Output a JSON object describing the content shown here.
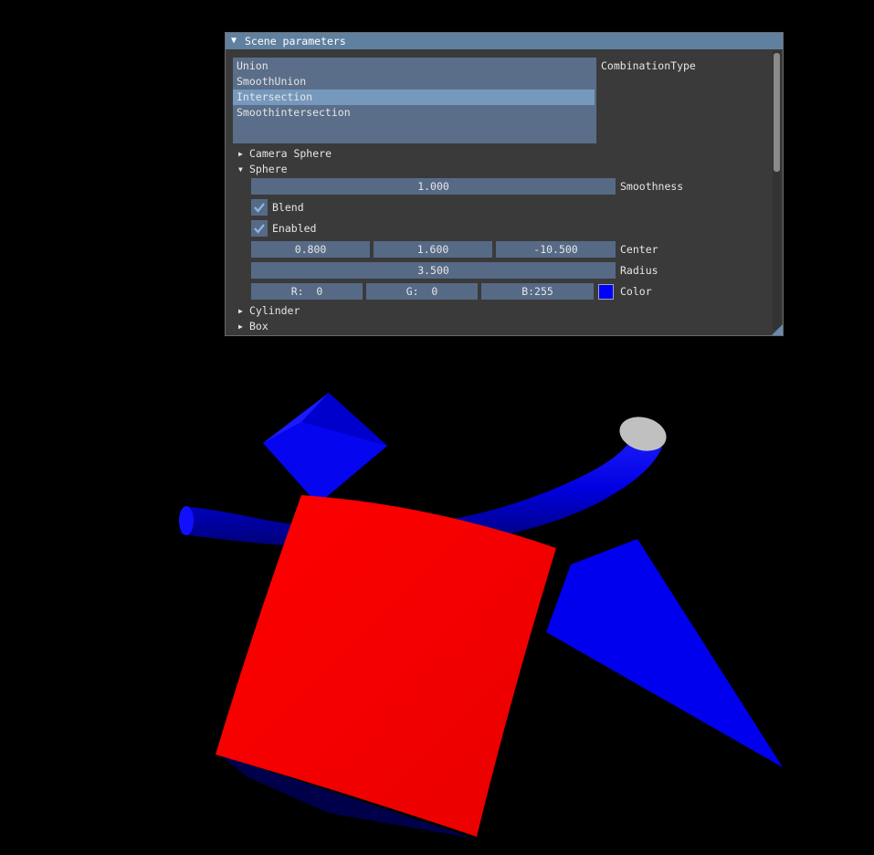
{
  "window": {
    "title": "Scene parameters",
    "combination_list": {
      "items": [
        "Union",
        "SmoothUnion",
        "Intersection",
        "Smoothintersection"
      ],
      "selected_index": 2,
      "label": "CombinationType"
    },
    "nodes": {
      "camera_sphere": "Camera Sphere",
      "sphere": "Sphere",
      "cylinder": "Cylinder",
      "box": "Box"
    },
    "sphere": {
      "smoothness_value": "1.000",
      "smoothness_label": "Smoothness",
      "blend_label": "Blend",
      "blend_checked": true,
      "enabled_label": "Enabled",
      "enabled_checked": true,
      "center_x": "0.800",
      "center_y": "1.600",
      "center_z": "-10.500",
      "center_label": "Center",
      "radius_value": "3.500",
      "radius_label": "Radius",
      "color_r": "R:  0",
      "color_g": "G:  0",
      "color_b": "B:255",
      "color_label": "Color",
      "color_hex": "#0000ff"
    }
  },
  "colors": {
    "background": "#000000",
    "title_bar": "#6080a0",
    "panel": "#3a3a3a",
    "widget": "#566a86",
    "selected": "#7698bd",
    "box_red": "#ee0000",
    "shape_blue": "#0000ee",
    "cylinder_cap": "#bfbfbf"
  }
}
